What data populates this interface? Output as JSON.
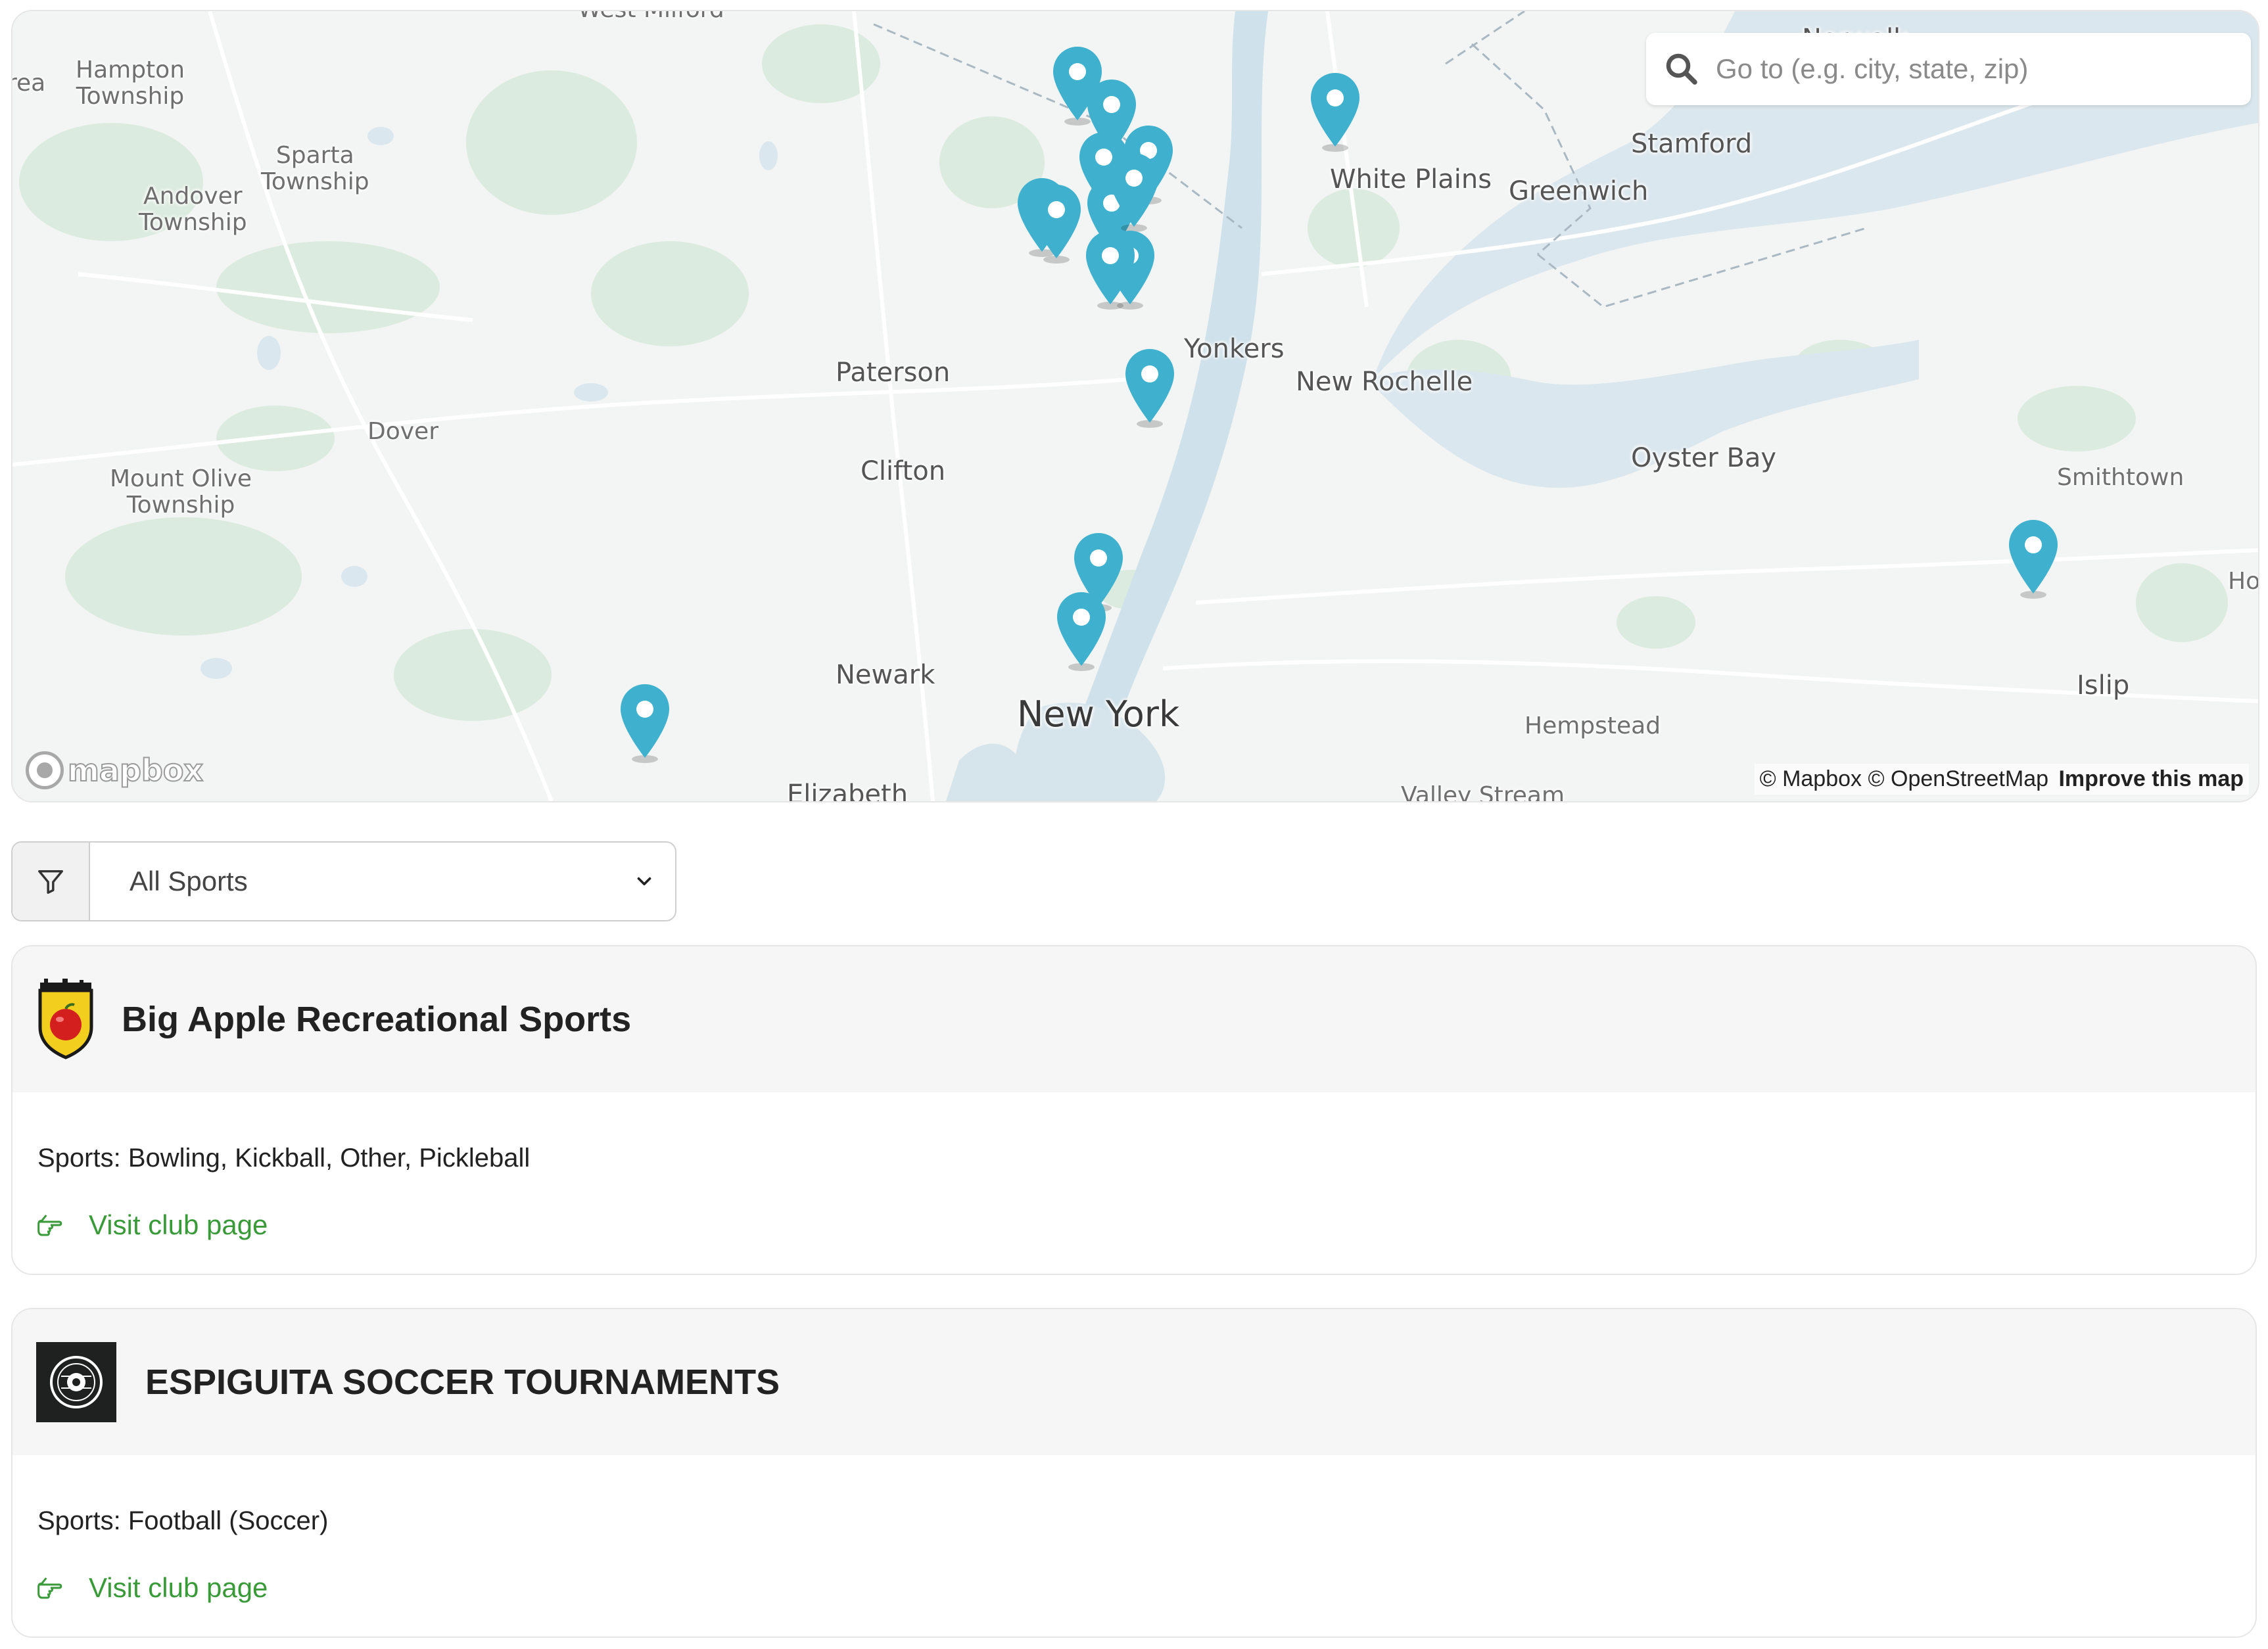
{
  "map": {
    "search": {
      "placeholder": "Go to (e.g. city, state, zip)"
    },
    "places": {
      "west_milford": "West Milford",
      "hampton": "Hampton",
      "hampton_2": "Township",
      "sparta": "Sparta",
      "sparta_2": "Township",
      "andover": "Andover",
      "andover_2": "Township",
      "norwalk": "Norwalk",
      "stamford": "Stamford",
      "white_plains": "White Plains",
      "greenwich": "Greenwich",
      "yonkers": "Yonkers",
      "new_rochelle": "New Rochelle",
      "paterson": "Paterson",
      "dover": "Dover",
      "clifton": "Clifton",
      "mount_olive": "Mount Olive",
      "mount_olive_2": "Township",
      "oyster_bay": "Oyster Bay",
      "smithtown": "Smithtown",
      "newark": "Newark",
      "new_york": "New York",
      "hempstead": "Hempstead",
      "islip": "Islip",
      "elizabeth": "Elizabeth",
      "valley_stream": "Valley Stream",
      "area_cut": "rea",
      "ho_cut": "Ho"
    },
    "logo": "mapbox",
    "attribution": {
      "mapbox": "© Mapbox",
      "osm": "© OpenStreetMap",
      "improve": "Improve this map"
    },
    "marker_color": "#3fb1ce"
  },
  "filter": {
    "selected": "All Sports"
  },
  "clubs": [
    {
      "name": "Big Apple Recreational Sports",
      "sports": "Sports: Bowling, Kickball, Other, Pickleball",
      "link": "Visit club page"
    },
    {
      "name": "ESPIGUITA SOCCER TOURNAMENTS",
      "sports": "Sports: Football (Soccer)",
      "link": "Visit club page"
    }
  ],
  "colors": {
    "link_green": "#3a9a3a",
    "card_header_bg": "#f6f6f6"
  }
}
